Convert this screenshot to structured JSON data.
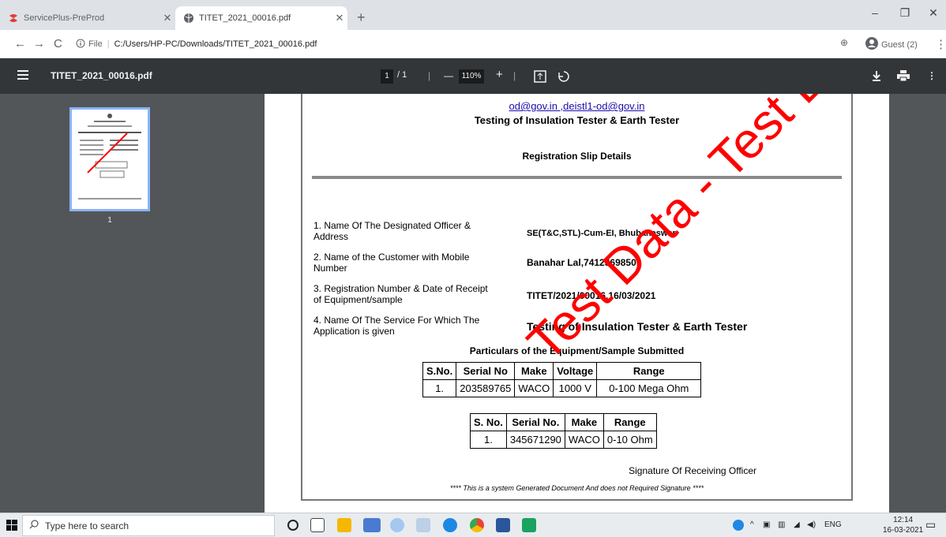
{
  "browser": {
    "tabs": [
      {
        "title": "ServicePlus-PreProd",
        "active": false
      },
      {
        "title": "TITET_2021_00016.pdf",
        "active": true
      }
    ],
    "address": {
      "file_label": "File",
      "url": "C:/Users/HP-PC/Downloads/TITET_2021_00016.pdf"
    },
    "profile": "Guest (2)"
  },
  "pdf_viewer": {
    "title": "TITET_2021_00016.pdf",
    "page_current": "1",
    "page_total": "/ 1",
    "zoom": "110%",
    "thumbnail_page": "1"
  },
  "document": {
    "emails": "od@gov.in ,deistl1-od@gov.in",
    "heading": "Testing of Insulation Tester & Earth Tester",
    "subheading": "Registration Slip Details",
    "fields": [
      {
        "label_line1": "1. Name Of The Designated Officer &",
        "label_line2": "Address",
        "value": "SE(T&C,STL)-Cum-EI, Bhubaneswar"
      },
      {
        "label_line1": "2. Name of the Customer with Mobile",
        "label_line2": "Number",
        "value": "Banahar Lal,7412369850"
      },
      {
        "label_line1": "3. Registration Number & Date of Receipt",
        "label_line2": "of Equipment/sample",
        "value": "TITET/2021/00016,16/03/2021"
      },
      {
        "label_line1": "4. Name Of The Service For Which The",
        "label_line2": "Application is given",
        "value": "Testing of Insulation Tester & Earth Tester"
      }
    ],
    "particulars_heading": "Particulars of the Equipment/Sample Submitted",
    "table1": {
      "headers": [
        "S.No.",
        "Serial No",
        "Make",
        "Voltage",
        "Range"
      ],
      "rows": [
        [
          "1.",
          "203589765",
          "WACO",
          "1000 V",
          "0-100 Mega Ohm"
        ]
      ]
    },
    "table2": {
      "headers": [
        "S. No.",
        "Serial No.",
        "Make",
        "Range"
      ],
      "rows": [
        [
          "1.",
          "345671290",
          "WACO",
          "0-10 Ohm"
        ]
      ]
    },
    "signature": "Signature Of Receiving Officer",
    "footer_note": "**** This is a system Generated Document And does not Required Signature ****",
    "watermark": "Test Data - Test Data"
  },
  "taskbar": {
    "search_placeholder": "Type here to search",
    "language": "ENG",
    "time": "12:14",
    "date": "16-03-2021"
  },
  "colors": {
    "watermark": "#ff0000",
    "link": "#1a0dab",
    "viewer_bg": "#525659",
    "toolbar_bg": "#323639"
  }
}
